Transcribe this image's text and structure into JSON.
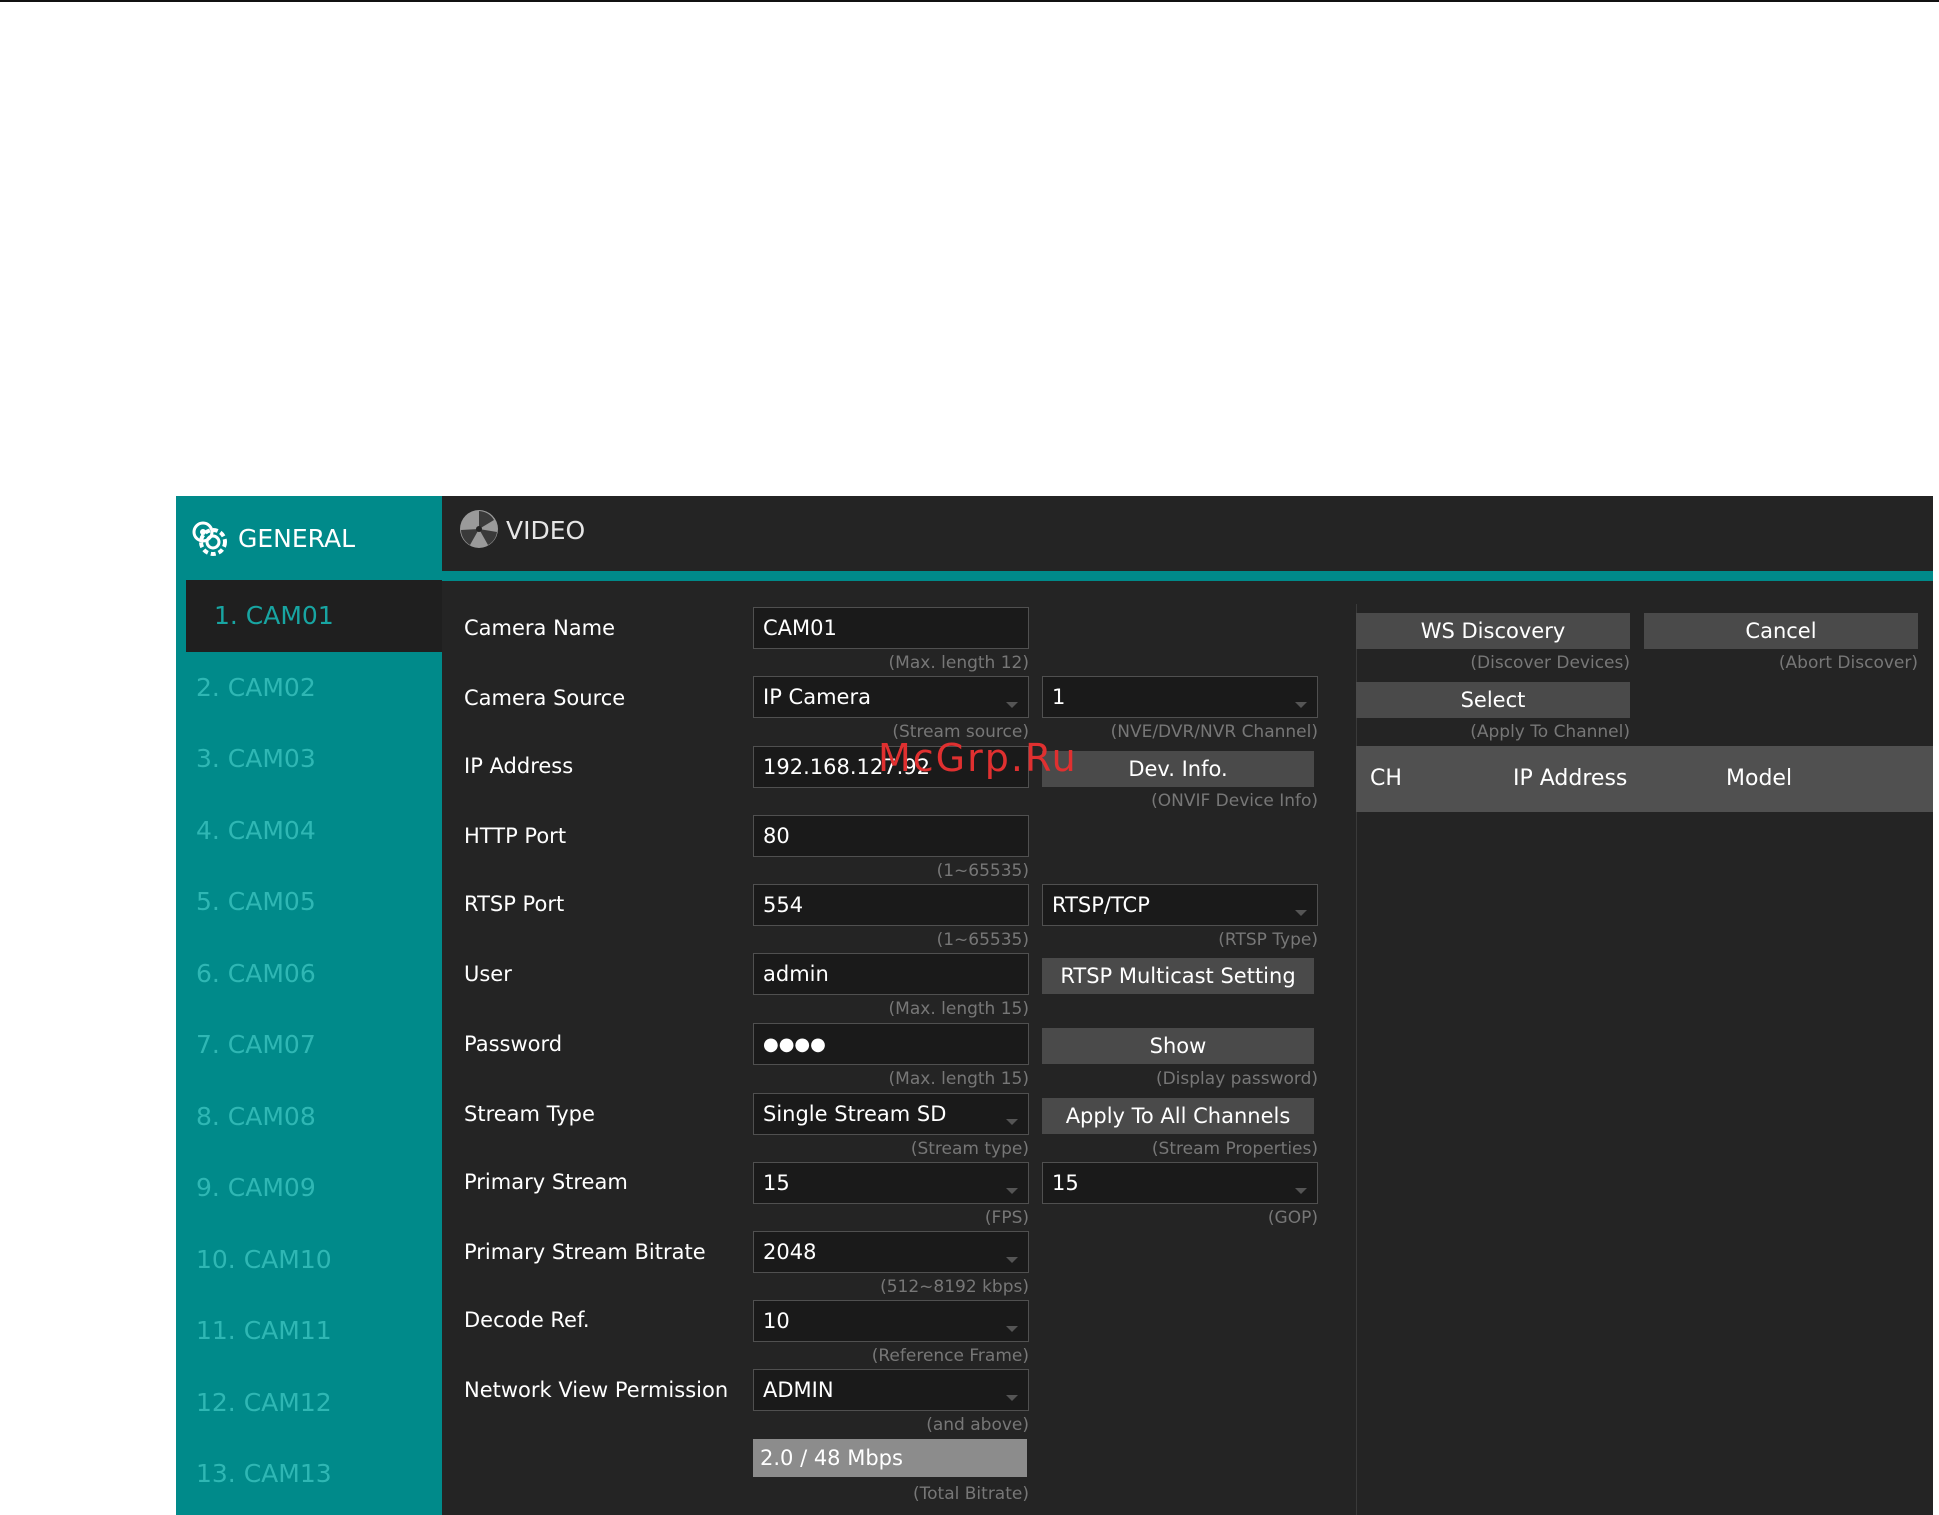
{
  "sidebar": {
    "title": "GENERAL",
    "icon": "gear-icon",
    "cameras": [
      "1. CAM01",
      "2. CAM02",
      "3. CAM03",
      "4. CAM04",
      "5. CAM05",
      "6. CAM06",
      "7. CAM07",
      "8. CAM08",
      "9. CAM09",
      "10. CAM10",
      "11. CAM11",
      "12. CAM12",
      "13. CAM13"
    ]
  },
  "header": {
    "title": "VIDEO",
    "icon": "film-reel-icon"
  },
  "form": {
    "camera_name": {
      "label": "Camera Name",
      "value": "CAM01",
      "hint": "(Max. length 12)"
    },
    "camera_source": {
      "label": "Camera Source",
      "value": "IP Camera",
      "hint": "(Stream source)",
      "channel": "1",
      "channel_hint": "(NVE/DVR/NVR Channel)"
    },
    "ip_address": {
      "label": "IP Address",
      "value": "192.168.127.92"
    },
    "dev_info": {
      "label": "Dev. Info.",
      "hint": "(ONVIF Device Info)"
    },
    "http_port": {
      "label": "HTTP Port",
      "value": "80",
      "hint": "(1~65535)"
    },
    "rtsp_port": {
      "label": "RTSP Port",
      "value": "554",
      "hint": "(1~65535)",
      "type": "RTSP/TCP",
      "type_hint": "(RTSP Type)"
    },
    "user": {
      "label": "User",
      "value": "admin",
      "hint": "(Max. length 15)"
    },
    "rtsp_multicast": {
      "label": "RTSP Multicast Setting"
    },
    "password": {
      "label": "Password",
      "value": "●●●●",
      "hint": "(Max. length 15)"
    },
    "show": {
      "label": "Show",
      "hint": "(Display password)"
    },
    "stream_type": {
      "label": "Stream Type",
      "value": "Single Stream SD",
      "hint": "(Stream type)"
    },
    "apply_all": {
      "label": "Apply To All Channels",
      "hint": "(Stream Properties)"
    },
    "primary_stream": {
      "label": "Primary Stream",
      "fps": "15",
      "fps_hint": "(FPS)",
      "gop": "15",
      "gop_hint": "(GOP)"
    },
    "primary_bitrate": {
      "label": "Primary Stream Bitrate",
      "value": "2048",
      "hint": "(512~8192 kbps)"
    },
    "decode_ref": {
      "label": "Decode Ref.",
      "value": "10",
      "hint": "(Reference Frame)"
    },
    "network_view": {
      "label": "Network View Permission",
      "value": "ADMIN",
      "hint": "(and above)"
    },
    "total_bitrate": {
      "value": "2.0 / 48 Mbps",
      "hint": "(Total Bitrate)"
    }
  },
  "discovery": {
    "ws_discovery": {
      "label": "WS Discovery",
      "hint": "(Discover Devices)"
    },
    "cancel": {
      "label": "Cancel",
      "hint": "(Abort Discover)"
    },
    "select": {
      "label": "Select",
      "hint": "(Apply To Channel)"
    },
    "columns": [
      "CH",
      "IP Address",
      "Model"
    ]
  },
  "watermark": "McGrp.Ru"
}
